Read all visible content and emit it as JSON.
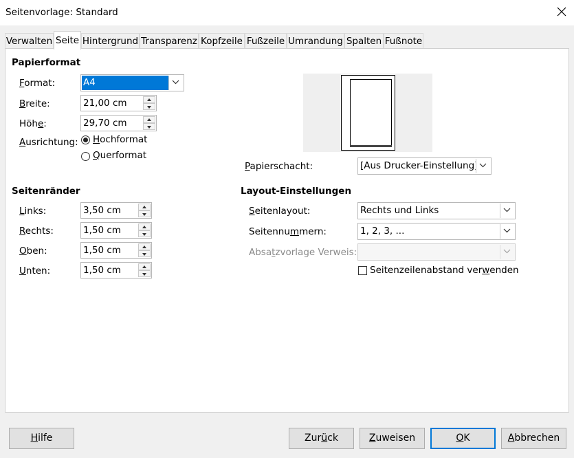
{
  "window": {
    "title": "Seitenvorlage: Standard",
    "close_icon": "close-icon"
  },
  "tabs": [
    {
      "label": "Verwalten",
      "active": false
    },
    {
      "label": "Seite",
      "active": true
    },
    {
      "label": "Hintergrund",
      "active": false
    },
    {
      "label": "Transparenz",
      "active": false
    },
    {
      "label": "Kopfzeile",
      "active": false
    },
    {
      "label": "Fußzeile",
      "active": false
    },
    {
      "label": "Umrandung",
      "active": false
    },
    {
      "label": "Spalten",
      "active": false
    },
    {
      "label": "Fußnote",
      "active": false
    }
  ],
  "paper_format": {
    "section_title": "Papierformat",
    "format_label_pre": "F",
    "format_label_rest": "ormat:",
    "format_value": "A4",
    "width_label_pre": "B",
    "width_label_rest": "reite:",
    "width_value": "21,00 cm",
    "height_label_pre": "Höh",
    "height_label_u": "e",
    "height_label_rest": ":",
    "height_value": "29,70 cm",
    "orientation_label_pre": "A",
    "orientation_label_rest": "usrichtung:",
    "portrait_label_pre": "H",
    "portrait_label_rest": "ochformat",
    "portrait_selected": true,
    "landscape_label_pre": "Q",
    "landscape_label_rest": "uerformat",
    "landscape_selected": false,
    "paper_tray_label_pre": "P",
    "paper_tray_label_rest": "apierschacht:",
    "paper_tray_value": "[Aus Drucker-Einstellung]"
  },
  "margins": {
    "section_title": "Seitenränder",
    "left_label_pre": "L",
    "left_label_rest": "inks:",
    "left_value": "3,50 cm",
    "right_label_pre": "R",
    "right_label_rest": "echts:",
    "right_value": "1,50 cm",
    "top_label_pre": "O",
    "top_label_rest": "ben:",
    "top_value": "1,50 cm",
    "bottom_label_pre": "U",
    "bottom_label_rest": "nten:",
    "bottom_value": "1,50 cm"
  },
  "layout": {
    "section_title": "Layout-Einstellungen",
    "page_layout_label_pre": "S",
    "page_layout_label_rest": "eitenlayout:",
    "page_layout_value": "Rechts und Links",
    "page_numbers_label_pre": "Seitennu",
    "page_numbers_label_u": "m",
    "page_numbers_label_rest": "mern:",
    "page_numbers_value": "1, 2, 3, ...",
    "ref_style_label_pre": "Absa",
    "ref_style_label_u": "t",
    "ref_style_label_rest": "zvorlage Verweis:",
    "ref_style_value": "",
    "register_true_label_pre": "Seitenzeilenabstand ver",
    "register_true_label_u": "w",
    "register_true_label_rest": "enden",
    "register_true_checked": false
  },
  "buttons": {
    "help_u": "H",
    "help_rest": "ilfe",
    "back_pre": "Zur",
    "back_u": "ü",
    "back_rest": "ck",
    "apply_u": "Z",
    "apply_rest": "uweisen",
    "ok_u": "O",
    "ok_rest": "K",
    "cancel_u": "A",
    "cancel_rest": "bbrechen"
  }
}
